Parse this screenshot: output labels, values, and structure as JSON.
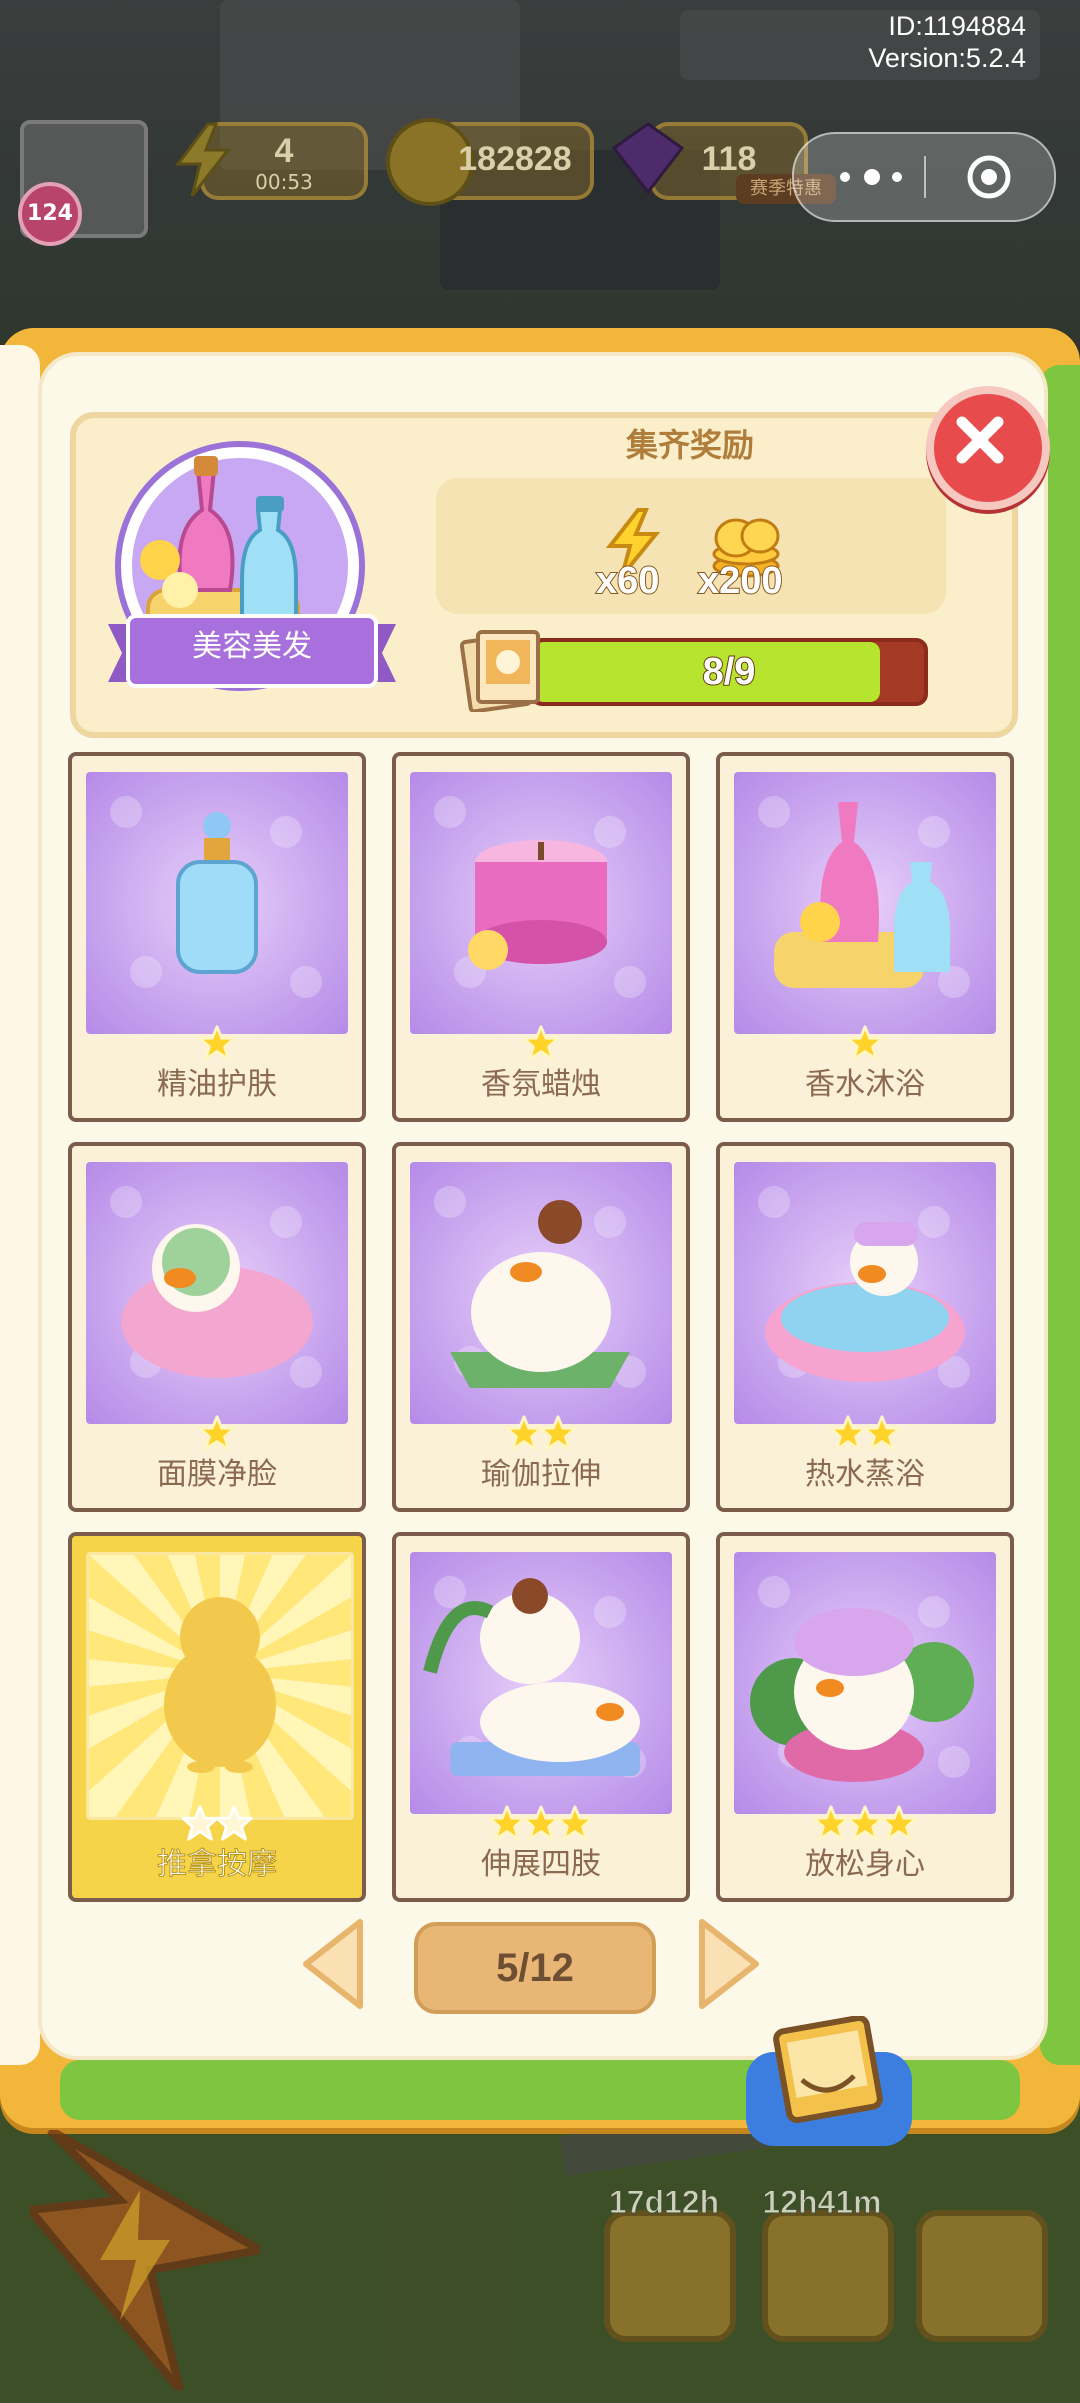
{
  "app": {
    "id_label": "ID:1194884",
    "version_label": "Version:5.2.4"
  },
  "hud": {
    "energy": {
      "value": "4",
      "timer": "00:53"
    },
    "coins": {
      "value": "182828"
    },
    "gems": {
      "value": "118"
    },
    "level": "124",
    "event_badge": "赛季特惠"
  },
  "collection": {
    "name": "美容美发",
    "reward_title": "集齐奖励",
    "rewards": [
      {
        "icon": "energy-bolt-icon",
        "label": "x60"
      },
      {
        "icon": "coin-stack-icon",
        "label": "x200"
      }
    ],
    "progress_label": "8/9",
    "progress_fraction": 0.888,
    "colors": {
      "progress_fill": "#b7e52f",
      "progress_track": "#a53a26"
    }
  },
  "cards": [
    {
      "name": "精油护肤",
      "stars": 1,
      "locked": false,
      "art": "oil-bottle-icon"
    },
    {
      "name": "香氛蜡烛",
      "stars": 1,
      "locked": false,
      "art": "candle-icon"
    },
    {
      "name": "香水沐浴",
      "stars": 1,
      "locked": false,
      "art": "bath-set-icon"
    },
    {
      "name": "面膜净脸",
      "stars": 1,
      "locked": false,
      "art": "duck-facemask-icon"
    },
    {
      "name": "瑜伽拉伸",
      "stars": 2,
      "locked": false,
      "art": "duck-yoga-icon"
    },
    {
      "name": "热水蒸浴",
      "stars": 2,
      "locked": false,
      "art": "duck-bathtub-icon"
    },
    {
      "name": "推拿按摩",
      "stars": 2,
      "locked": true,
      "art": "duck-silhouette-icon"
    },
    {
      "name": "伸展四肢",
      "stars": 3,
      "locked": false,
      "art": "duck-stretch-icon"
    },
    {
      "name": "放松身心",
      "stars": 3,
      "locked": false,
      "art": "duck-relax-icon"
    }
  ],
  "pager": {
    "label": "5/12"
  },
  "bottom": {
    "timer_1": "17d12h",
    "timer_2": "12h41m"
  }
}
